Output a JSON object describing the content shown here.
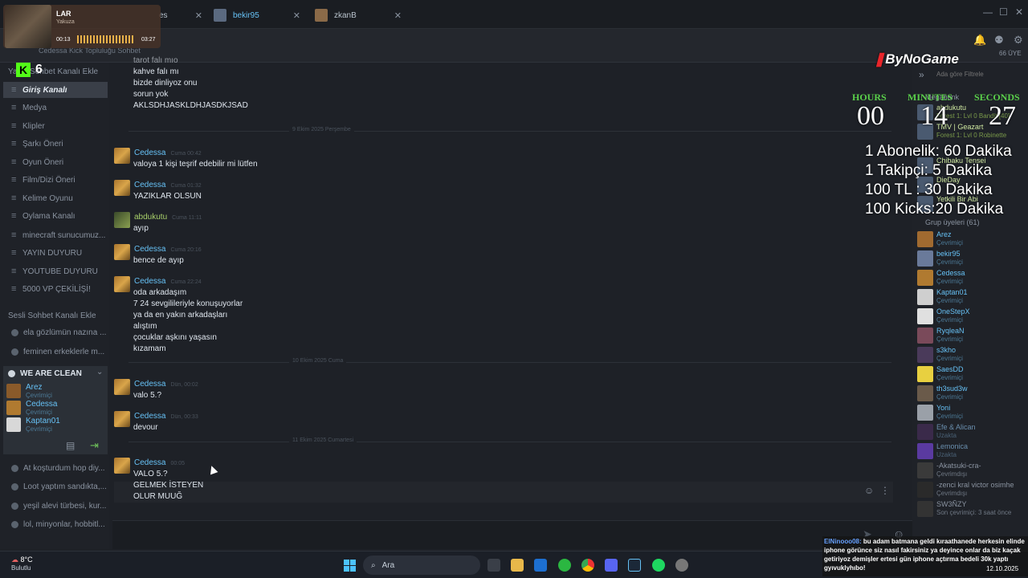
{
  "tabs": [
    {
      "label": "es"
    },
    {
      "label": "bekir95"
    },
    {
      "label": "zkanB"
    }
  ],
  "overlay": {
    "title": "LAR",
    "subtitle": "Yakuza",
    "time_elapsed": "00:13",
    "time_total": "03:27"
  },
  "header": {
    "group_name": "Cedessa Kick Topluluğu Sohbet"
  },
  "kick": {
    "logo": "K",
    "count": "6"
  },
  "sidebar": {
    "text_header": "Yazılı Sohbet Kanalı Ekle",
    "channels": [
      {
        "label": "Giriş Kanalı",
        "active": true
      },
      {
        "label": "Medya"
      },
      {
        "label": "Klipler"
      },
      {
        "label": "Şarkı Öneri"
      },
      {
        "label": "Oyun Öneri"
      },
      {
        "label": "Film/Dizi Öneri"
      },
      {
        "label": "Kelime Oyunu"
      },
      {
        "label": "Oylama Kanalı"
      },
      {
        "label": "minecraft sunucumuz..."
      },
      {
        "label": "YAYIN DUYURU"
      },
      {
        "label": "YOUTUBE DUYURU"
      },
      {
        "label": "5000 VP ÇEKİLİŞİ!"
      }
    ],
    "voice_header": "Sesli Sohbet Kanalı Ekle",
    "voice_channels_top": [
      {
        "label": "ela gözlümün nazına ..."
      },
      {
        "label": "feminen erkeklerle m..."
      }
    ],
    "active_voice": {
      "title": "WE ARE CLEAN",
      "members": [
        {
          "name": "Arez",
          "status": "Çevrimiçi"
        },
        {
          "name": "Cedessa",
          "status": "Çevrimiçi"
        },
        {
          "name": "Kaptan01",
          "status": "Çevrimiçi"
        }
      ]
    },
    "voice_channels_bottom": [
      {
        "label": "At koşturdum hop diy..."
      },
      {
        "label": "Loot yaptım sandıkta,..."
      },
      {
        "label": "yeşil alevi türbesi, kur..."
      },
      {
        "label": "lol, minyonlar, hobbitl..."
      }
    ]
  },
  "chat": {
    "earlier_lines": [
      "tarot falı mıo",
      "kahve falı mı",
      "bizde dinliyoz onu",
      "sorun yok",
      "AKLSDHJASKLDHJASDKJSAD"
    ],
    "separators": [
      "9 Ekim 2025 Perşembe",
      "10 Ekim 2025 Cuma",
      "11 Ekim 2025 Cumartesi"
    ],
    "messages": [
      {
        "name": "Cedessa",
        "time": "Cuma 00:42",
        "lines": [
          "valoya 1 kişi teşrif edebilir mi lütfen"
        ]
      },
      {
        "name": "Cedessa",
        "time": "Cuma 01:32",
        "lines": [
          "YAZIKLAR OLSUN"
        ]
      },
      {
        "name": "abdukutu",
        "time": "Cuma 11:11",
        "lines": [
          "ayıp"
        ]
      },
      {
        "name": "Cedessa",
        "time": "Cuma 20:16",
        "lines": [
          "bence de ayıp"
        ]
      },
      {
        "name": "Cedessa",
        "time": "Cuma 22:24",
        "lines": [
          "oda arkadaşım",
          "7 24 sevgilileriyle konuşuyorlar",
          "ya da en yakın arkadaşları",
          "alıştım",
          "çocuklar aşkını yaşasın",
          "kızamam"
        ]
      },
      {
        "name": "Cedessa",
        "time": "Dün, 00:02",
        "lines": [
          "valo 5.?"
        ]
      },
      {
        "name": "Cedessa",
        "time": "Dün, 00:33",
        "lines": [
          "devour"
        ]
      },
      {
        "name": "Cedessa",
        "time": "00:05",
        "lines": [
          "VALO 5.?",
          "GELMEK İSTEYEN",
          "OLUR MUUĞ"
        ]
      }
    ],
    "input_placeholder": ""
  },
  "timer": {
    "brand": "ByNoGame",
    "hours_label": "HOURS",
    "minutes_label": "MINUTES",
    "seconds_label": "SECONDS",
    "hours": "00",
    "minutes": "14",
    "seconds": "27",
    "rules": [
      "1 Abonelik: 60 Dakika",
      "1 Takipçi: 5 Dakika",
      "100 TL : 30 Dakika",
      "100 Kicks:20 Dakika"
    ]
  },
  "members": {
    "count_label": "66 ÜYE",
    "search_placeholder": "Ada göre Filtrele",
    "ingame_header": "Megabonk",
    "ingame": [
      {
        "name": "abdukutu",
        "status": "Forest 1: Lvl 0 Bandit [40]"
      },
      {
        "name": "TMV | Geazart",
        "status": "Forest 1: Lvl 0 Robinette"
      },
      {
        "name": "Chibaku Tensei",
        "status": ""
      },
      {
        "name": "DieDay",
        "status": ""
      },
      {
        "name": "Yetkili Bir Abi",
        "status": ""
      }
    ],
    "group_header": "Grup üyeleri (61)",
    "group": [
      {
        "name": "Arez",
        "status": "Çevrimiçi",
        "state": "on"
      },
      {
        "name": "bekir95",
        "status": "Çevrimiçi",
        "state": "on"
      },
      {
        "name": "Cedessa",
        "status": "Çevrimiçi",
        "state": "on"
      },
      {
        "name": "Kaptan01",
        "status": "Çevrimiçi",
        "state": "on"
      },
      {
        "name": "OneStepX",
        "status": "Çevrimiçi",
        "state": "on"
      },
      {
        "name": "RyqleaN",
        "status": "Çevrimiçi",
        "state": "on"
      },
      {
        "name": "s3kho",
        "status": "Çevrimiçi",
        "state": "on"
      },
      {
        "name": "SaesDD",
        "status": "Çevrimiçi",
        "state": "on"
      },
      {
        "name": "th3sud3w",
        "status": "Çevrimiçi",
        "state": "on"
      },
      {
        "name": "Yoni",
        "status": "Çevrimiçi",
        "state": "on"
      },
      {
        "name": "Efe & Alican",
        "status": "Uzakta",
        "state": "away"
      },
      {
        "name": "Lemonica",
        "status": "Uzakta",
        "state": "away"
      },
      {
        "name": "-Akatsuki-cra-",
        "status": "Çevrimdışı",
        "state": "off"
      },
      {
        "name": "-zenci kral victor osimhe",
        "status": "Çevrimdışı",
        "state": "off"
      },
      {
        "name": "SW3ÑZY",
        "status": "Son çevrimiçi: 3 saat önce",
        "state": "off"
      }
    ]
  },
  "ticker": {
    "user": "ElNinooo08:",
    "text": "bu adam batmana geldi kıraathanede herkesin elinde iphone görünce siz nasıl fakirsiniz ya deyince onlar da biz kaçak getiriyoz demişler ertesi gün iphone açtırma bedeli 30k yaptı gyıvuklyhıbo!"
  },
  "taskbar": {
    "temp": "8°C",
    "weather": "Bulutlu",
    "search": "Ara",
    "date": "12.10.2025"
  },
  "colors": {
    "accent": "#66c0f4",
    "kick": "#53fc18",
    "timer_label": "#5ad04a"
  }
}
